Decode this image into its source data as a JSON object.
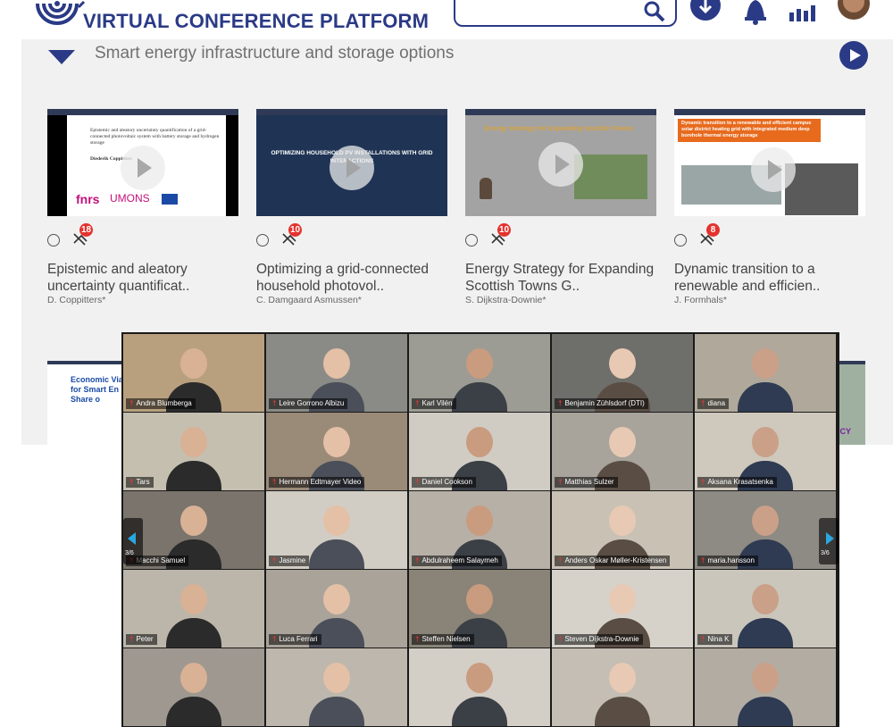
{
  "header": {
    "brand": "VIRTUAL CONFERENCE PLATFORM",
    "icons": [
      "logo-icon",
      "search-icon",
      "download-icon",
      "bell-icon",
      "stats-icon",
      "avatar"
    ]
  },
  "section": {
    "title": "Smart energy infrastructure and storage options"
  },
  "cards": [
    {
      "title_line1": "Epistemic and aleatory",
      "title_line2": "uncertainty quantificat..",
      "author": "D. Coppitters*",
      "badge": "18",
      "thumb_text": "Epistemic and aleatory uncertainty quantification of a grid-connected photovoltaic system with battery storage and hydrogen storage",
      "thumb_author": "Diederik Coppitters"
    },
    {
      "title_line1": "Optimizing a grid-connected",
      "title_line2": "household photovol..",
      "author": "C. Damgaard Asmussen*",
      "badge": "10",
      "thumb_text": "OPTIMIZING HOUSEHOLD PV INSTALLATIONS WITH GRID INTERACTIONS"
    },
    {
      "title_line1": "Energy Strategy for Expanding",
      "title_line2": "Scottish Towns G..",
      "author": "S. Dijkstra-Downie*",
      "badge": "10",
      "thumb_text": "Energy Strategy for Expanding Scottish Towns"
    },
    {
      "title_line1": "Dynamic transition to a",
      "title_line2": "renewable and efficien..",
      "author": "J. Formhals*",
      "badge": "8",
      "thumb_text": "Dynamic transition to a renewable and efficient campus solar district heating grid with integrated medium deep borehole thermal energy storage"
    }
  ],
  "partial_cards": {
    "left_text": "Economic Via for Smart En Share o",
    "right_text": "ICY"
  },
  "video_call": {
    "page_indicator_left": "3/6",
    "page_indicator_right": "3/6",
    "participants": [
      "Andra Blumberga",
      "Leire Gorrono Albizu",
      "Karl Vilén",
      "Benjamin Zühlsdorf (DTI)",
      "diana",
      "Tars",
      "Hermann Edtmayer Video",
      "Daniel Cookson",
      "Matthias Sulzer",
      "Aksana Krasatsenka",
      "Macchi Samuel",
      "Jasmine",
      "Abdulraheem Salaymeh",
      "Anders Oskar Møller-Kristensen",
      "maria.hansson",
      "Peter",
      "Luca Ferrari",
      "Steffen Nielsen",
      "Steven Dijkstra-Downie",
      "Nina K",
      "",
      "",
      "",
      "",
      ""
    ]
  },
  "colors": {
    "brand": "#2a3a86",
    "badge": "#e5322d",
    "panel": "#f1f1f1"
  }
}
